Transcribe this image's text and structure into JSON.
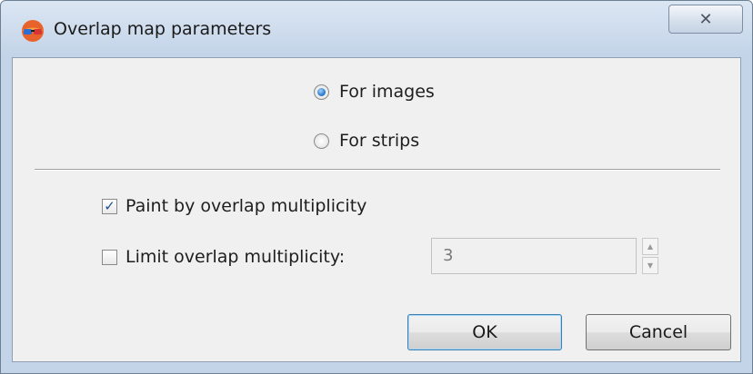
{
  "window": {
    "title": "Overlap map parameters",
    "icon": "colored-glasses-icon",
    "close_glyph": "✕"
  },
  "mode": {
    "options": [
      {
        "label": "For images",
        "checked": true
      },
      {
        "label": "For strips",
        "checked": false
      }
    ]
  },
  "options": {
    "paint_by_overlap": {
      "label": "Paint by overlap multiplicity",
      "checked": true
    },
    "limit_overlap": {
      "label": "Limit overlap multiplicity:",
      "checked": false,
      "value": "3",
      "enabled": false
    }
  },
  "buttons": {
    "ok": "OK",
    "cancel": "Cancel"
  },
  "colors": {
    "title_gradient_top": "#dbe6f3",
    "client_bg": "#f0f0f0",
    "radio_accent": "#1f6fc4",
    "check_mark": "#1d4f91"
  }
}
